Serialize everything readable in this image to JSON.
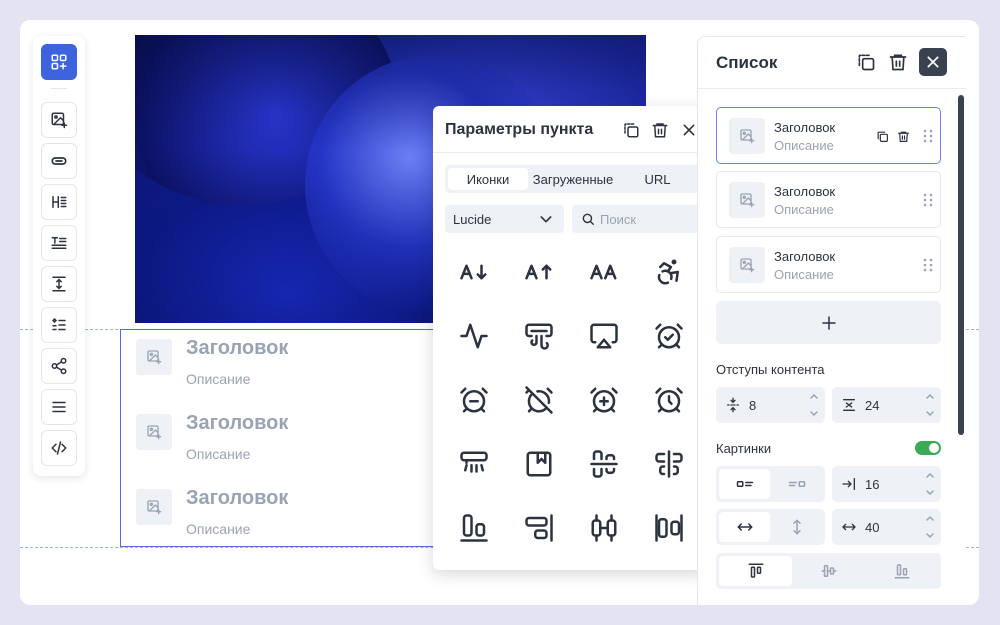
{
  "canvas": {
    "list_items": [
      {
        "title": "Заголовок",
        "description": "Описание"
      },
      {
        "title": "Заголовок",
        "description": "Описание"
      },
      {
        "title": "Заголовок",
        "description": "Описание"
      }
    ]
  },
  "toolbar": {
    "buttons": [
      "add-block-icon",
      "image-add-icon",
      "link-icon",
      "heading-icon",
      "text-icon",
      "spacing-icon",
      "list-icon",
      "share-icon",
      "menu-icon",
      "code-icon"
    ]
  },
  "popup": {
    "title": "Параметры пункта",
    "tabs": [
      {
        "label": "Иконки",
        "active": true
      },
      {
        "label": "Загруженные",
        "active": false
      },
      {
        "label": "URL",
        "active": false
      }
    ],
    "library": "Lucide",
    "search_placeholder": "Поиск",
    "icons": [
      "arrow-down-a-z-icon",
      "arrow-up-a-z-icon",
      "case-upper-icon",
      "accessibility-icon",
      "activity-icon",
      "air-vent-icon",
      "airplay-icon",
      "alarm-check-icon",
      "alarm-minus-icon",
      "alarm-off-icon",
      "alarm-plus-icon",
      "alarm-clock-icon",
      "air-conditioner-icon",
      "album-icon",
      "align-center-horizontal-icon",
      "align-center-vertical-icon",
      "align-bottom-icon",
      "align-end-icon",
      "align-horizontal-space-icon",
      "align-vertical-space-icon"
    ]
  },
  "panel": {
    "title": "Список",
    "items": [
      {
        "title": "Заголовок",
        "description": "Описание",
        "selected": true
      },
      {
        "title": "Заголовок",
        "description": "Описание",
        "selected": false
      },
      {
        "title": "Заголовок",
        "description": "Описание",
        "selected": false
      }
    ],
    "content_padding_label": "Отступы контента",
    "padding_vertical": "8",
    "padding_horizontal": "24",
    "images_label": "Картинки",
    "images_enabled": true,
    "image_offset": "16",
    "image_size": "40"
  },
  "colors": {
    "accent": "#3d63dd",
    "toggle_on": "#3aaa57",
    "dark": "#3a4150"
  }
}
